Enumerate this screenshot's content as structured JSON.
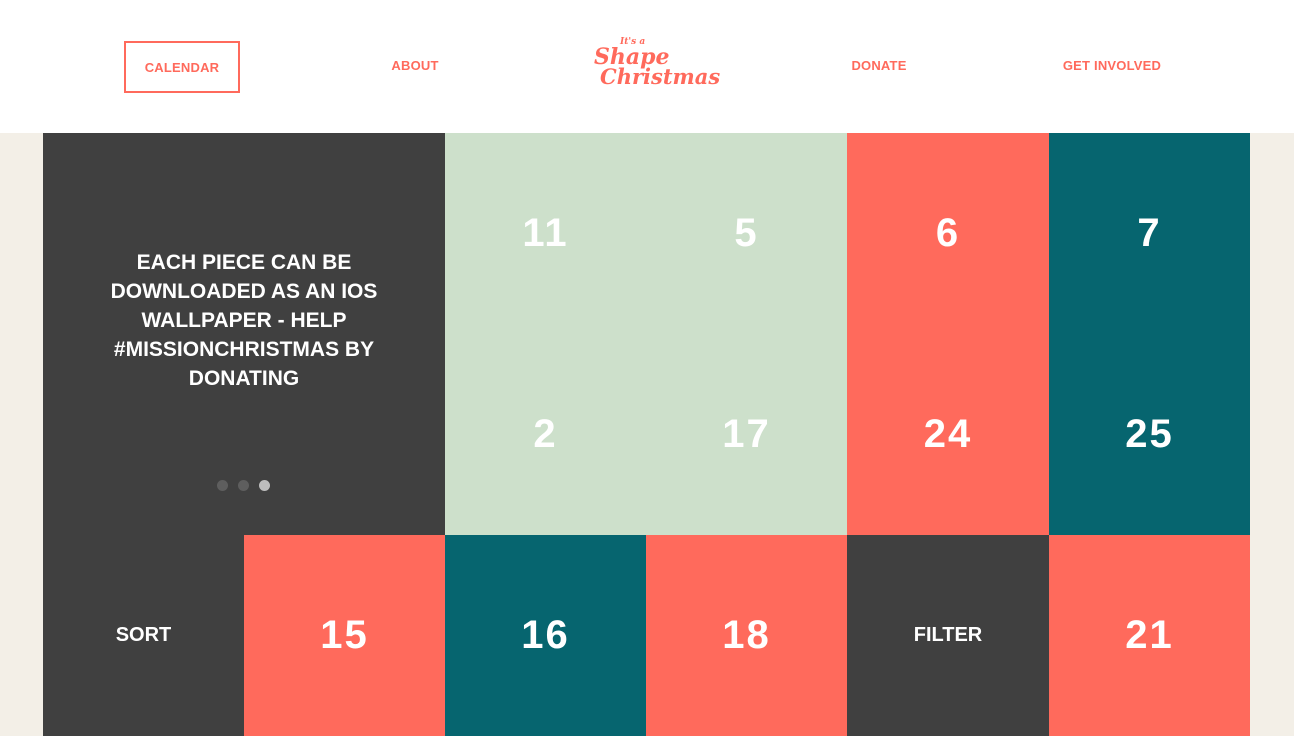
{
  "colors": {
    "accent": "#ff6a5c",
    "dark": "#404040",
    "mint": "#cde0cb",
    "teal": "#06656f",
    "cream": "#f3efe7"
  },
  "nav": {
    "calendar": "CALENDAR",
    "about": "ABOUT",
    "donate": "DONATE",
    "involved": "GET INVOLVED"
  },
  "logo": {
    "line1": "It's a",
    "line2": "Shape",
    "line3": "Christmas"
  },
  "info": {
    "text": "EACH PIECE CAN BE DOWNLOADED AS AN IOS WALLPAPER - HELP #MISSIONCHRISTMAS BY DONATING",
    "dots_count": 3,
    "active_dot": 3
  },
  "tiles": [
    {
      "label": "11",
      "color": "mint"
    },
    {
      "label": "5",
      "color": "mint"
    },
    {
      "label": "6",
      "color": "accent"
    },
    {
      "label": "7",
      "color": "teal"
    },
    {
      "label": "2",
      "color": "mint"
    },
    {
      "label": "17",
      "color": "mint"
    },
    {
      "label": "24",
      "color": "accent"
    },
    {
      "label": "25",
      "color": "teal"
    },
    {
      "label": "15",
      "color": "accent"
    },
    {
      "label": "16",
      "color": "teal"
    },
    {
      "label": "18",
      "color": "accent"
    },
    {
      "label": "21",
      "color": "accent"
    }
  ],
  "controls": {
    "sort": "SORT",
    "filter": "FILTER"
  }
}
